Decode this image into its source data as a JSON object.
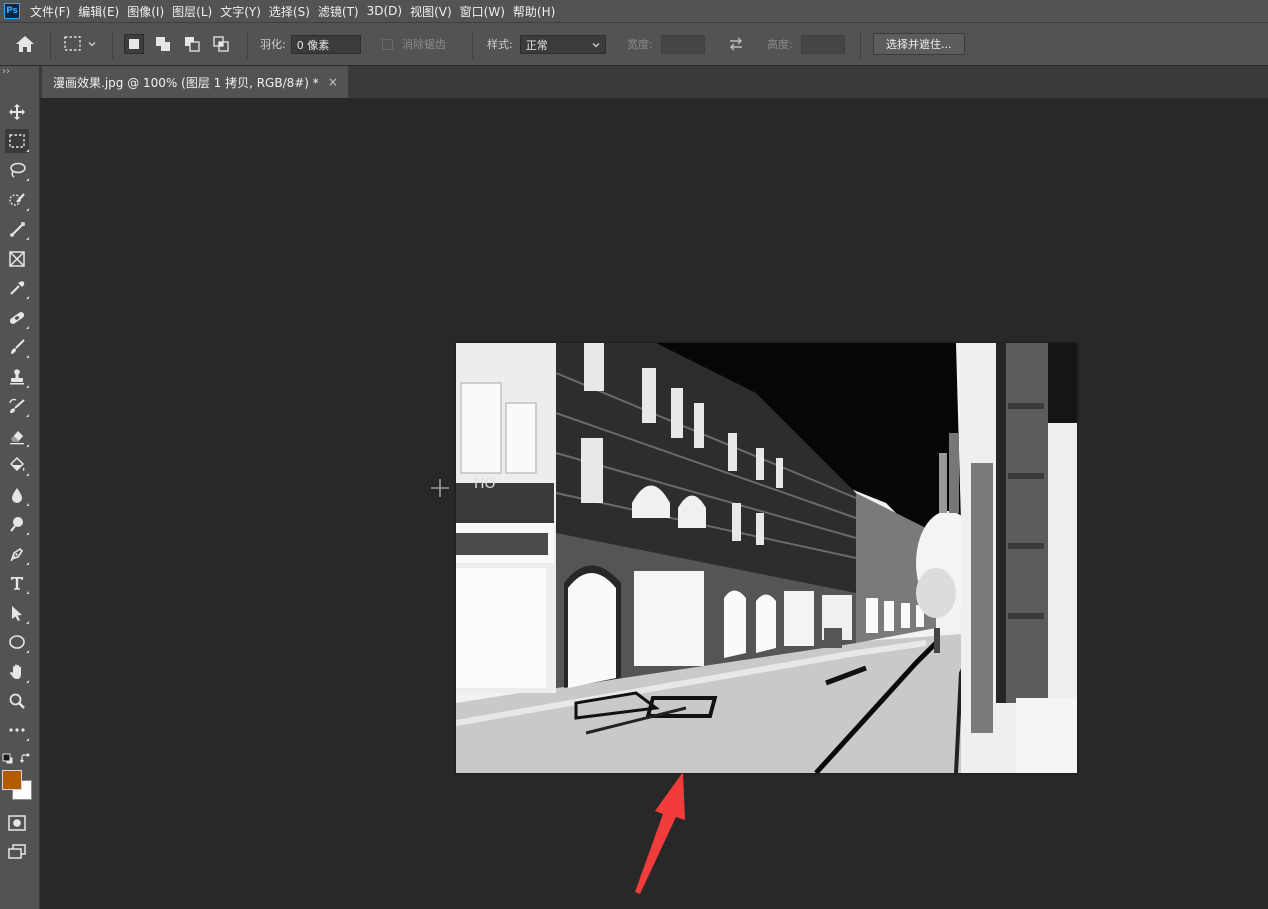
{
  "app": {
    "logo": "Ps"
  },
  "menu": [
    "文件(F)",
    "编辑(E)",
    "图像(I)",
    "图层(L)",
    "文字(Y)",
    "选择(S)",
    "滤镜(T)",
    "3D(D)",
    "视图(V)",
    "窗口(W)",
    "帮助(H)"
  ],
  "options": {
    "feather_label": "羽化:",
    "feather_value": "0 像素",
    "antialias_label": "消除锯齿",
    "style_label": "样式:",
    "style_value": "正常",
    "width_label": "宽度:",
    "height_label": "高度:",
    "select_mask_label": "选择并遮住..."
  },
  "document": {
    "tab_title": "漫画效果.jpg @ 100% (图层 1 拷贝, RGB/8#) *",
    "tab_close": "×",
    "sign_text": "HO"
  },
  "colors": {
    "foreground": "#b35a00",
    "background": "#ffffff",
    "annotation_arrow": "#f23b3b"
  },
  "icons": {
    "tools": [
      "move-icon",
      "marquee-icon",
      "lasso-icon",
      "quick-select-icon",
      "crop-icon",
      "frame-icon",
      "eyedropper-icon",
      "healing-brush-icon",
      "brush-icon",
      "clone-stamp-icon",
      "history-brush-icon",
      "eraser-icon",
      "paint-bucket-icon",
      "blur-icon",
      "dodge-icon",
      "pen-icon",
      "type-icon",
      "path-select-icon",
      "ellipse-icon",
      "hand-icon",
      "zoom-icon",
      "more-tools-icon"
    ]
  }
}
